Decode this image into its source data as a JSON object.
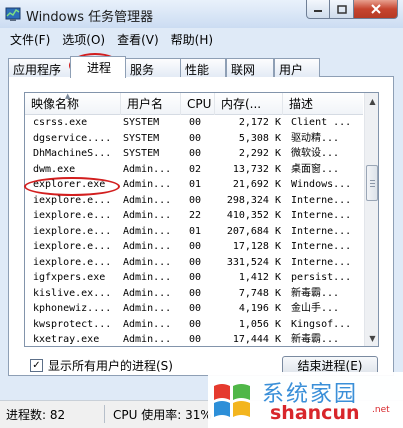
{
  "window": {
    "title": "Windows 任务管理器"
  },
  "menu": [
    "文件(F)",
    "选项(O)",
    "查看(V)",
    "帮助(H)"
  ],
  "tabs": [
    "应用程序",
    "进程",
    "服务",
    "性能",
    "联网",
    "用户"
  ],
  "active_tab": "进程",
  "columns": [
    "映像名称",
    "用户名",
    "CPU",
    "内存(...",
    "描述"
  ],
  "processes": [
    {
      "name": "csrss.exe",
      "user": "SYSTEM",
      "cpu": "00",
      "mem": "2,172 K",
      "desc": "Client ..."
    },
    {
      "name": "dgservice....",
      "user": "SYSTEM",
      "cpu": "00",
      "mem": "5,308 K",
      "desc": "驱动精..."
    },
    {
      "name": "DhMachineS...",
      "user": "SYSTEM",
      "cpu": "00",
      "mem": "2,292 K",
      "desc": "微软设..."
    },
    {
      "name": "dwm.exe",
      "user": "Admin...",
      "cpu": "02",
      "mem": "13,732 K",
      "desc": "桌面窗..."
    },
    {
      "name": "explorer.exe",
      "user": "Admin...",
      "cpu": "01",
      "mem": "21,692 K",
      "desc": "Windows..."
    },
    {
      "name": "iexplore.e...",
      "user": "Admin...",
      "cpu": "00",
      "mem": "298,324 K",
      "desc": "Interne..."
    },
    {
      "name": "iexplore.e...",
      "user": "Admin...",
      "cpu": "22",
      "mem": "410,352 K",
      "desc": "Interne..."
    },
    {
      "name": "iexplore.e...",
      "user": "Admin...",
      "cpu": "01",
      "mem": "207,684 K",
      "desc": "Interne..."
    },
    {
      "name": "iexplore.e...",
      "user": "Admin...",
      "cpu": "00",
      "mem": "17,128 K",
      "desc": "Interne..."
    },
    {
      "name": "iexplore.e...",
      "user": "Admin...",
      "cpu": "00",
      "mem": "331,524 K",
      "desc": "Interne..."
    },
    {
      "name": "igfxpers.exe",
      "user": "Admin...",
      "cpu": "00",
      "mem": "1,412 K",
      "desc": "persist..."
    },
    {
      "name": "kislive.ex...",
      "user": "Admin...",
      "cpu": "00",
      "mem": "7,748 K",
      "desc": "新毒霸..."
    },
    {
      "name": "kphonewiz....",
      "user": "Admin...",
      "cpu": "00",
      "mem": "4,196 K",
      "desc": "金山手..."
    },
    {
      "name": "kwsprotect...",
      "user": "Admin...",
      "cpu": "00",
      "mem": "1,056 K",
      "desc": "Kingsof..."
    },
    {
      "name": "kxetray.exe",
      "user": "Admin...",
      "cpu": "00",
      "mem": "17,444 K",
      "desc": "新毒霸..."
    }
  ],
  "show_all_users": {
    "label": "显示所有用户的进程(S)",
    "checked": true
  },
  "end_process_button": "结束进程(E)",
  "status": {
    "processes": "进程数: 82",
    "cpu": "CPU 使用率: 31%"
  },
  "watermark": {
    "cn": "系统家园",
    "en": "shancun",
    "net": ".net"
  },
  "colors": {
    "annotation": "#d21e1e",
    "watermark_blue": "#3a8fd8",
    "watermark_red": "#d8262b"
  }
}
